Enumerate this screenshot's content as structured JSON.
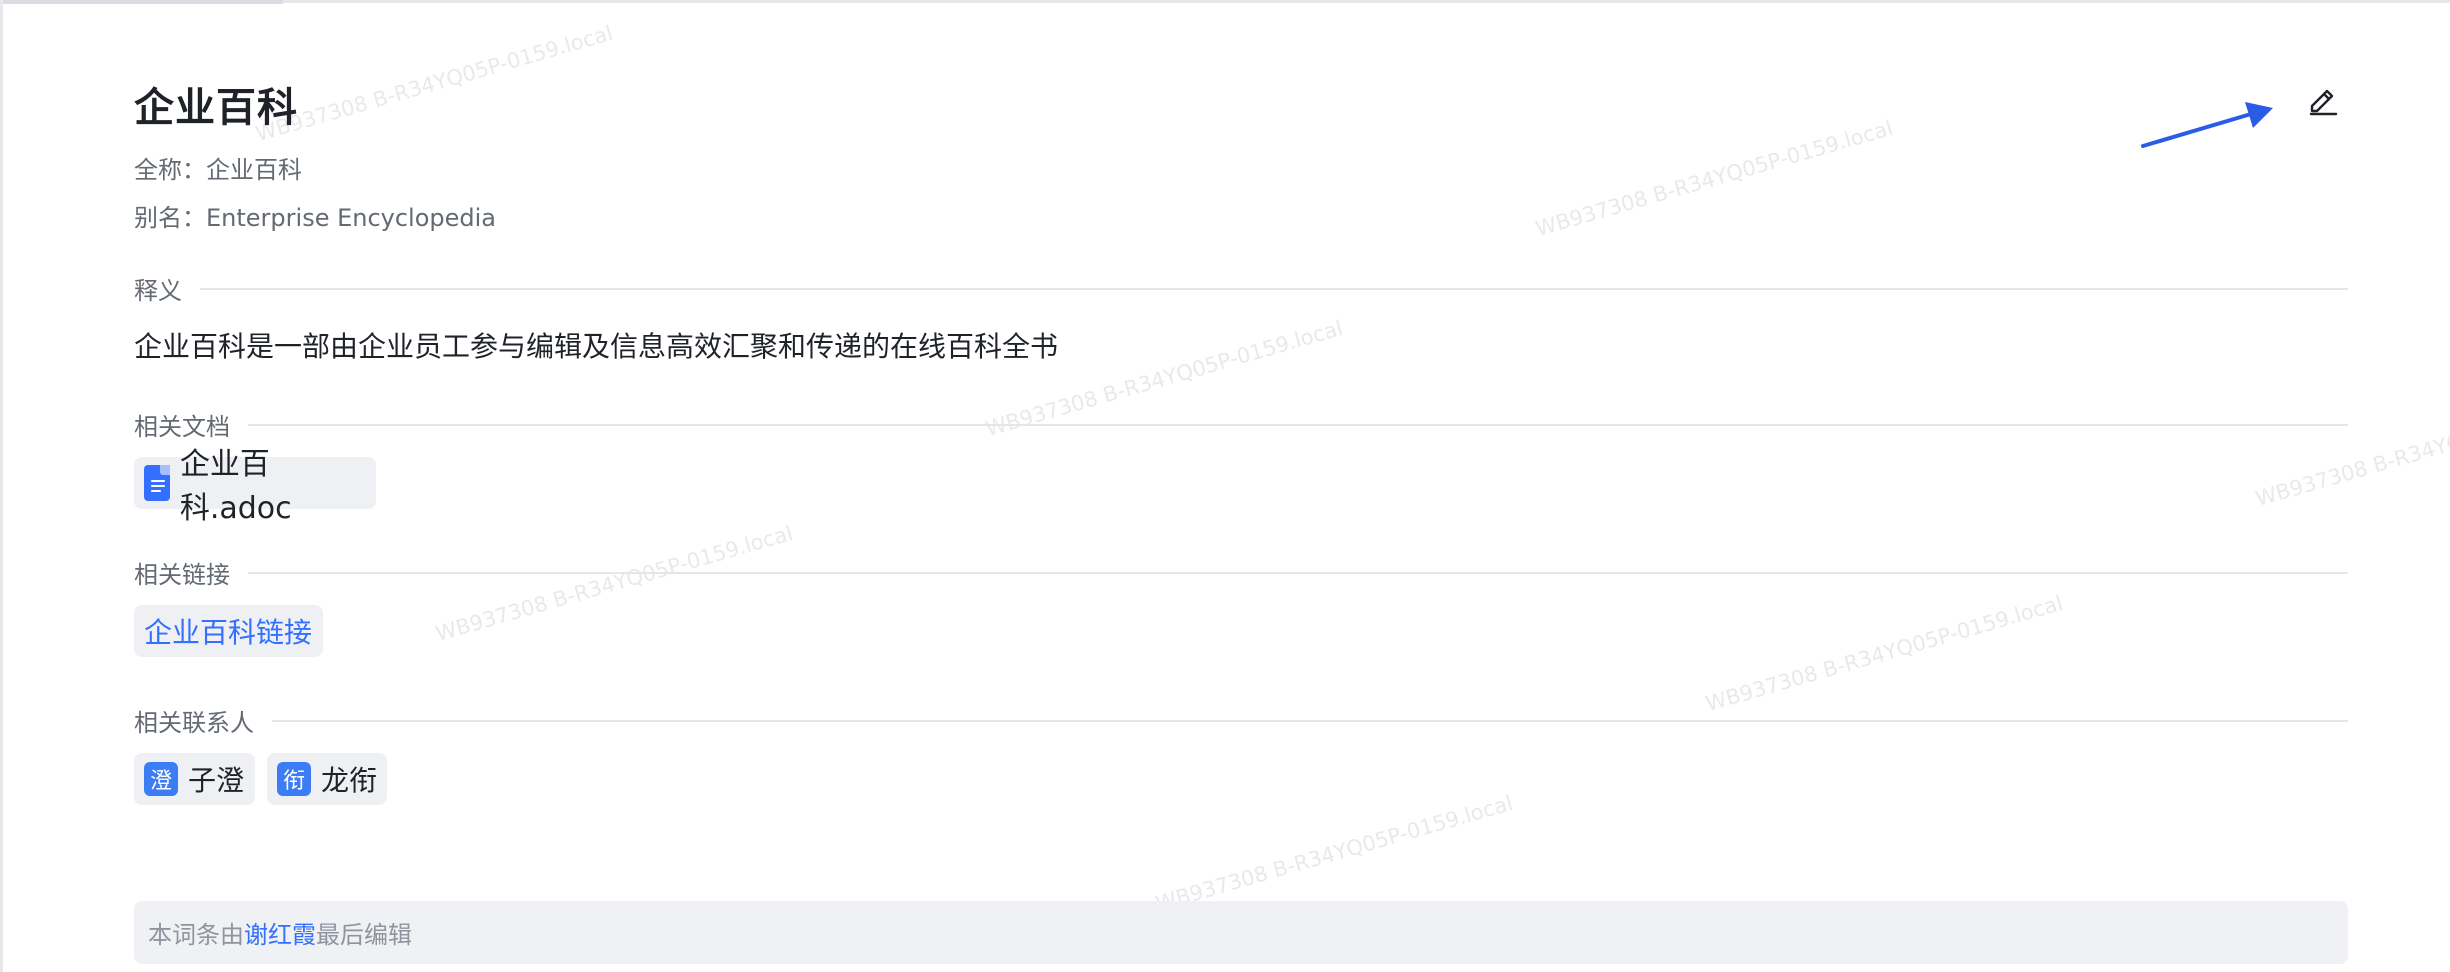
{
  "entry": {
    "title": "企业百科",
    "full_name_label": "全称：",
    "full_name": "企业百科",
    "alias_label": "别名：",
    "alias": "Enterprise Encyclopedia"
  },
  "sections": {
    "definition_label": "释义",
    "definition_text": "企业百科是一部由企业员工参与编辑及信息高效汇聚和传递的在线百科全书",
    "docs_label": "相关文档",
    "docs": [
      {
        "name": "企业百科.adoc",
        "icon": "doc-file-icon"
      }
    ],
    "links_label": "相关链接",
    "links": [
      {
        "label": "企业百科链接"
      }
    ],
    "contacts_label": "相关联系人",
    "contacts": [
      {
        "avatar_char": "澄",
        "name": "子澄"
      },
      {
        "avatar_char": "衔",
        "name": "龙衔"
      }
    ]
  },
  "footer": {
    "prefix": "本词条由",
    "editor": "谢红霞",
    "suffix": "最后编辑"
  },
  "toolbar": {
    "edit_icon": "pencil-icon"
  },
  "watermark": "WB937308 B-R34YQ05P-0159.local",
  "colors": {
    "accent": "#3370ff",
    "avatar": "#3c7df5",
    "annotation_arrow": "#2b5ce6"
  }
}
